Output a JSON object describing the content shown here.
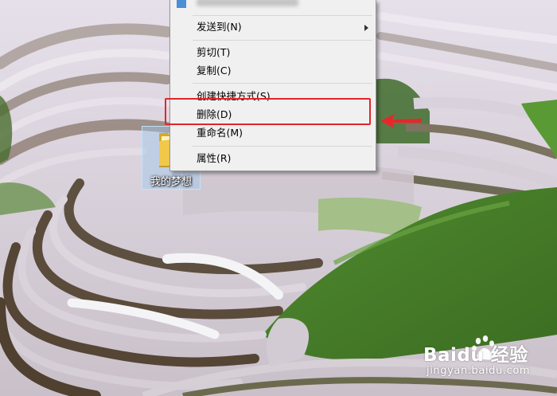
{
  "desktop": {
    "folder_icon": "folder-icon",
    "folder_label": "我的梦想"
  },
  "context_menu": {
    "top_item_icon": "app-icon",
    "items": [
      {
        "label": "发送到(N)",
        "has_submenu": true
      },
      {
        "label": "剪切(T)"
      },
      {
        "label": "复制(C)"
      },
      {
        "label": "创建快捷方式(S)"
      },
      {
        "label": "删除(D)"
      },
      {
        "label": "重命名(M)"
      },
      {
        "label": "属性(R)"
      }
    ]
  },
  "annotation": {
    "highlight_color": "#e0262b",
    "arrow_icon": "red-arrow-left-icon",
    "highlighted_item": "删除(D)"
  },
  "watermark": {
    "logo_icon": "baidu-paw-icon",
    "brand": "Baidu 经验",
    "site": "jingyan.baidu.com"
  }
}
